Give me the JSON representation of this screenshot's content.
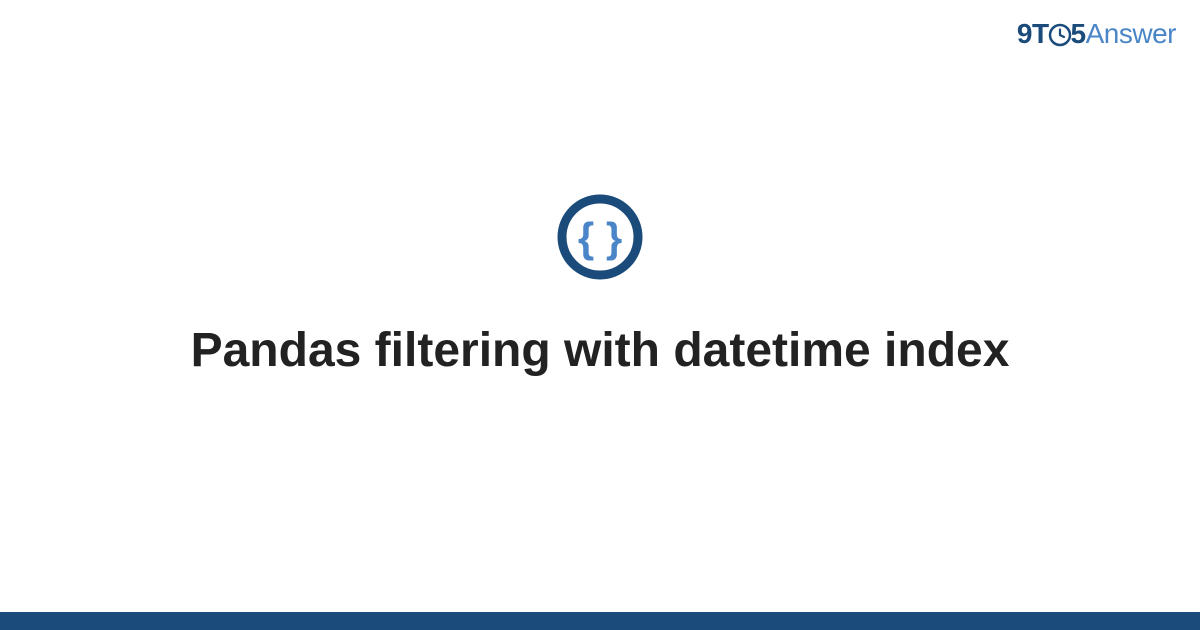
{
  "brand": {
    "nine": "9",
    "t": "T",
    "five": "5",
    "answer": "Answer"
  },
  "title": "Pandas filtering with datetime index",
  "colors": {
    "primary": "#1b4b7a",
    "accent": "#4a86c7",
    "text": "#222222"
  }
}
